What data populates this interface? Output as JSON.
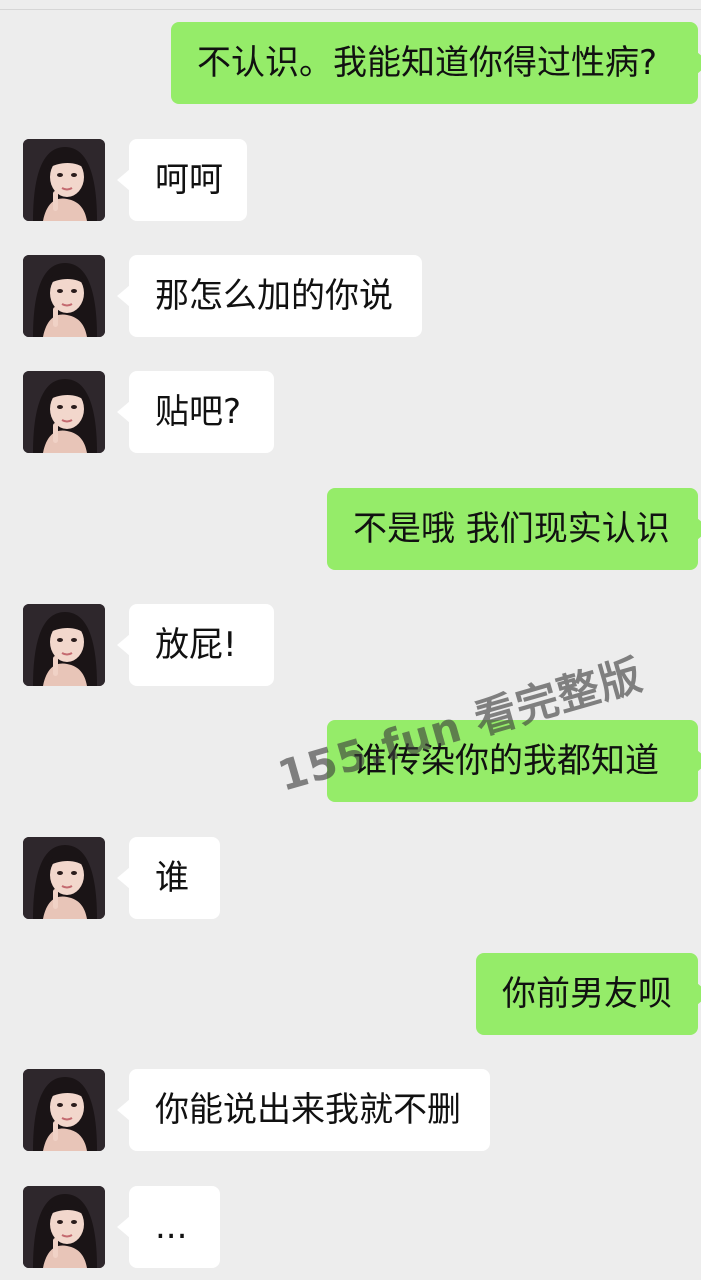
{
  "messages": [
    {
      "from": "me",
      "text": "不认识。我能知道你得过性病?"
    },
    {
      "from": "them",
      "text": "呵呵"
    },
    {
      "from": "them",
      "text": "那怎么加的你说"
    },
    {
      "from": "them",
      "text": "贴吧?"
    },
    {
      "from": "me",
      "text": "不是哦 我们现实认识"
    },
    {
      "from": "them",
      "text": "放屁!"
    },
    {
      "from": "me",
      "text": "谁传染你的我都知道"
    },
    {
      "from": "them",
      "text": "谁"
    },
    {
      "from": "me",
      "text": "你前男友呗"
    },
    {
      "from": "them",
      "text": "你能说出来我就不删"
    },
    {
      "from": "them",
      "text": "..."
    }
  ],
  "watermark": "155.fun 看完整版",
  "colors": {
    "background": "#ededed",
    "outgoing_bubble": "#95ec69",
    "incoming_bubble": "#ffffff"
  }
}
